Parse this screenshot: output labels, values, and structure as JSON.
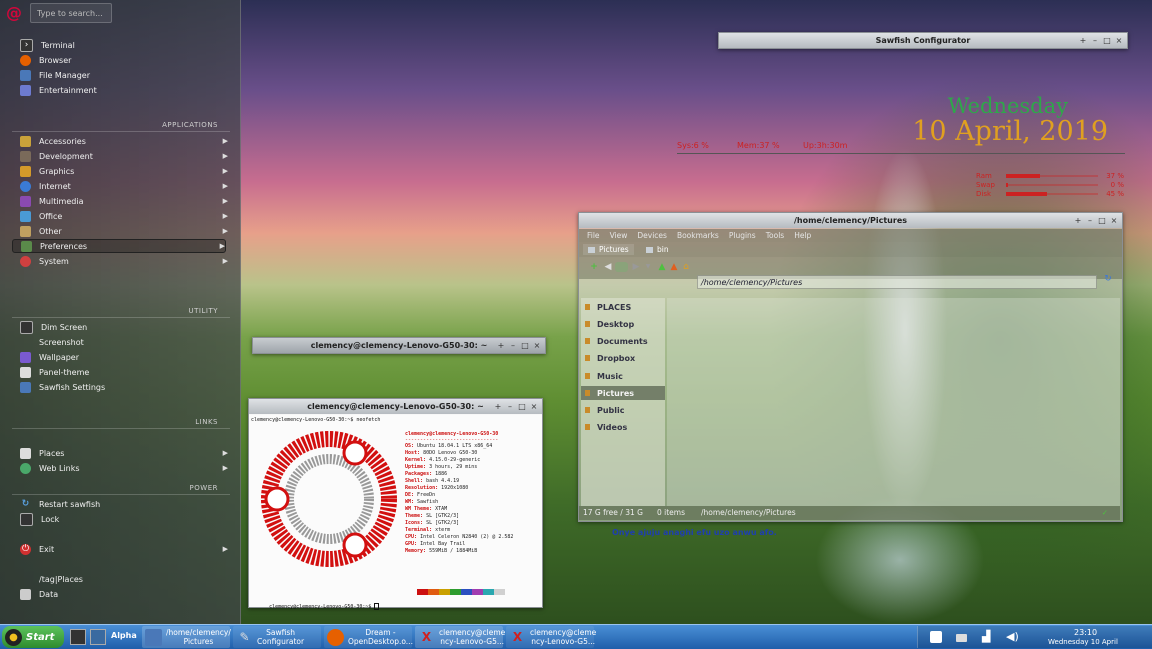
{
  "start_menu": {
    "search_placeholder": "Type to search...",
    "favorites": [
      {
        "label": "Terminal",
        "icon": "terminal-icon"
      },
      {
        "label": "Browser",
        "icon": "firefox-icon"
      },
      {
        "label": "File Manager",
        "icon": "folder-icon"
      },
      {
        "label": "Entertainment",
        "icon": "media-icon"
      }
    ],
    "applications_header": "APPLICATIONS",
    "applications": [
      {
        "label": "Accessories"
      },
      {
        "label": "Development"
      },
      {
        "label": "Graphics"
      },
      {
        "label": "Internet"
      },
      {
        "label": "Multimedia"
      },
      {
        "label": "Office"
      },
      {
        "label": "Other"
      },
      {
        "label": "Preferences"
      },
      {
        "label": "System"
      }
    ],
    "utility_header": "UTILITY",
    "utility": [
      {
        "label": "Dim Screen"
      },
      {
        "label": "Screenshot"
      },
      {
        "label": "Wallpaper"
      },
      {
        "label": "Panel-theme"
      },
      {
        "label": "Sawfish Settings"
      }
    ],
    "links_header": "LINKS",
    "links": [
      {
        "label": "Places"
      },
      {
        "label": "Web Links"
      }
    ],
    "power_header": "POWER",
    "power": [
      {
        "label": "Restart sawfish"
      },
      {
        "label": "Lock"
      },
      {
        "label": "Exit"
      }
    ],
    "tag_places": "/tag|Places",
    "data_label": "Data"
  },
  "windows": {
    "sawfish_configurator": {
      "title": "Sawfish Configurator"
    },
    "terminal_shaded": {
      "title": "clemency@clemency-Lenovo-G50-30: ~"
    },
    "terminal": {
      "title": "clemency@clemency-Lenovo-G50-30: ~",
      "prompt_line": "clemency@clemency-Lenovo-G50-30:~$ neofetch",
      "userhost": "clemency@clemency-Lenovo-G50-30",
      "info": [
        {
          "k": "OS:",
          "v": "Ubuntu 18.04.1 LTS x86_64"
        },
        {
          "k": "Host:",
          "v": "80DO Lenovo G50-30"
        },
        {
          "k": "Kernel:",
          "v": "4.15.0-29-generic"
        },
        {
          "k": "Uptime:",
          "v": "3 hours, 29 mins"
        },
        {
          "k": "Packages:",
          "v": "1886"
        },
        {
          "k": "Shell:",
          "v": "bash 4.4.19"
        },
        {
          "k": "Resolution:",
          "v": "1920x1080"
        },
        {
          "k": "DE:",
          "v": "FreeDn"
        },
        {
          "k": "WM:",
          "v": "Sawfish"
        },
        {
          "k": "WM Theme:",
          "v": "XTAM"
        },
        {
          "k": "Theme:",
          "v": "SL [GTK2/3]"
        },
        {
          "k": "Icons:",
          "v": "SL [GTK2/3]"
        },
        {
          "k": "Terminal:",
          "v": "xterm"
        },
        {
          "k": "CPU:",
          "v": "Intel Celeron N2840 (2) @ 2.582"
        },
        {
          "k": "GPU:",
          "v": "Intel Bay Trail"
        },
        {
          "k": "Memory:",
          "v": "559MiB / 1884MiB"
        }
      ],
      "end_prompt": "clemency@clemency-Lenovo-G50-30:~$"
    },
    "file_manager": {
      "title": "/home/clemency/Pictures",
      "menus": [
        "File",
        "View",
        "Devices",
        "Bookmarks",
        "Plugins",
        "Tools",
        "Help"
      ],
      "tabs": [
        "Pictures",
        "bin"
      ],
      "path": "/home/clemency/Pictures",
      "places_header": "PLACES",
      "places": [
        "Desktop",
        "Documents",
        "Dropbox",
        "Music",
        "Pictures",
        "Public",
        "Videos"
      ],
      "status_space": "17 G free / 31 G",
      "status_items": "0 items",
      "status_path": "/home/clemency/Pictures"
    }
  },
  "conky": {
    "day": "Wednesday",
    "date": "10 April, 2019",
    "sys": "Sys:6 %",
    "mem": "Mem:37 %",
    "up": "Up:3h:30m",
    "quote": "Onye ajuju anaghi efu uzo anwu afo.",
    "bars": [
      {
        "label": "Ram",
        "pct": "37 %",
        "fraction": 0.37
      },
      {
        "label": "Swap",
        "pct": "0 %",
        "fraction": 0.02
      },
      {
        "label": "Disk",
        "pct": "45 %",
        "fraction": 0.45
      }
    ],
    "colors": {
      "day": "#2ea84a",
      "date": "#e0a020",
      "stats": "#cc2222"
    }
  },
  "taskbar": {
    "start_label": "Start",
    "desk_label": "Alpha",
    "tasks": [
      {
        "line1": "/home/clemency/",
        "line2": "Pictures"
      },
      {
        "line1": "Sawfish",
        "line2": "Configurator"
      },
      {
        "line1": "Dream -",
        "line2": "OpenDesktop.o..."
      },
      {
        "line1": "clemency@cleme",
        "line2": "ncy-Lenovo-G5..."
      },
      {
        "line1": "clemency@cleme",
        "line2": "ncy-Lenovo-G5..."
      }
    ],
    "clock_time": "23:10",
    "clock_date": "Wednesday 10 April"
  }
}
